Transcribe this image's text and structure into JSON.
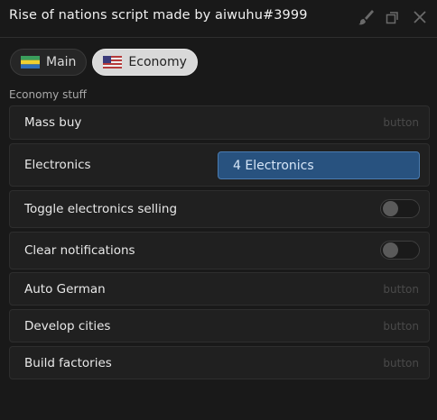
{
  "window": {
    "title": "Rise of nations script made by aiwuhu#3999",
    "icons": [
      "paintbrush-icon",
      "restore-icon",
      "close-icon"
    ]
  },
  "tabs": [
    {
      "label": "Main",
      "icon": "flag-gabon-icon",
      "active": false
    },
    {
      "label": "Economy",
      "icon": "flag-usa-icon",
      "active": true
    }
  ],
  "section": {
    "label": "Economy stuff"
  },
  "rows": [
    {
      "label": "Mass buy",
      "type": "button",
      "hint": "button"
    },
    {
      "label": "Electronics",
      "type": "dropdown",
      "value": "4 Electronics"
    },
    {
      "label": "Toggle electronics selling",
      "type": "toggle",
      "on": false
    },
    {
      "label": "Clear notifications",
      "type": "toggle",
      "on": false
    },
    {
      "label": "Auto German",
      "type": "button",
      "hint": "button"
    },
    {
      "label": "Develop cities",
      "type": "button",
      "hint": "button"
    },
    {
      "label": "Build factories",
      "type": "button",
      "hint": "button"
    }
  ],
  "colors": {
    "background": "#191919",
    "row": "#202020",
    "accent": "#28527f",
    "accent_border": "#4a7bb0"
  }
}
